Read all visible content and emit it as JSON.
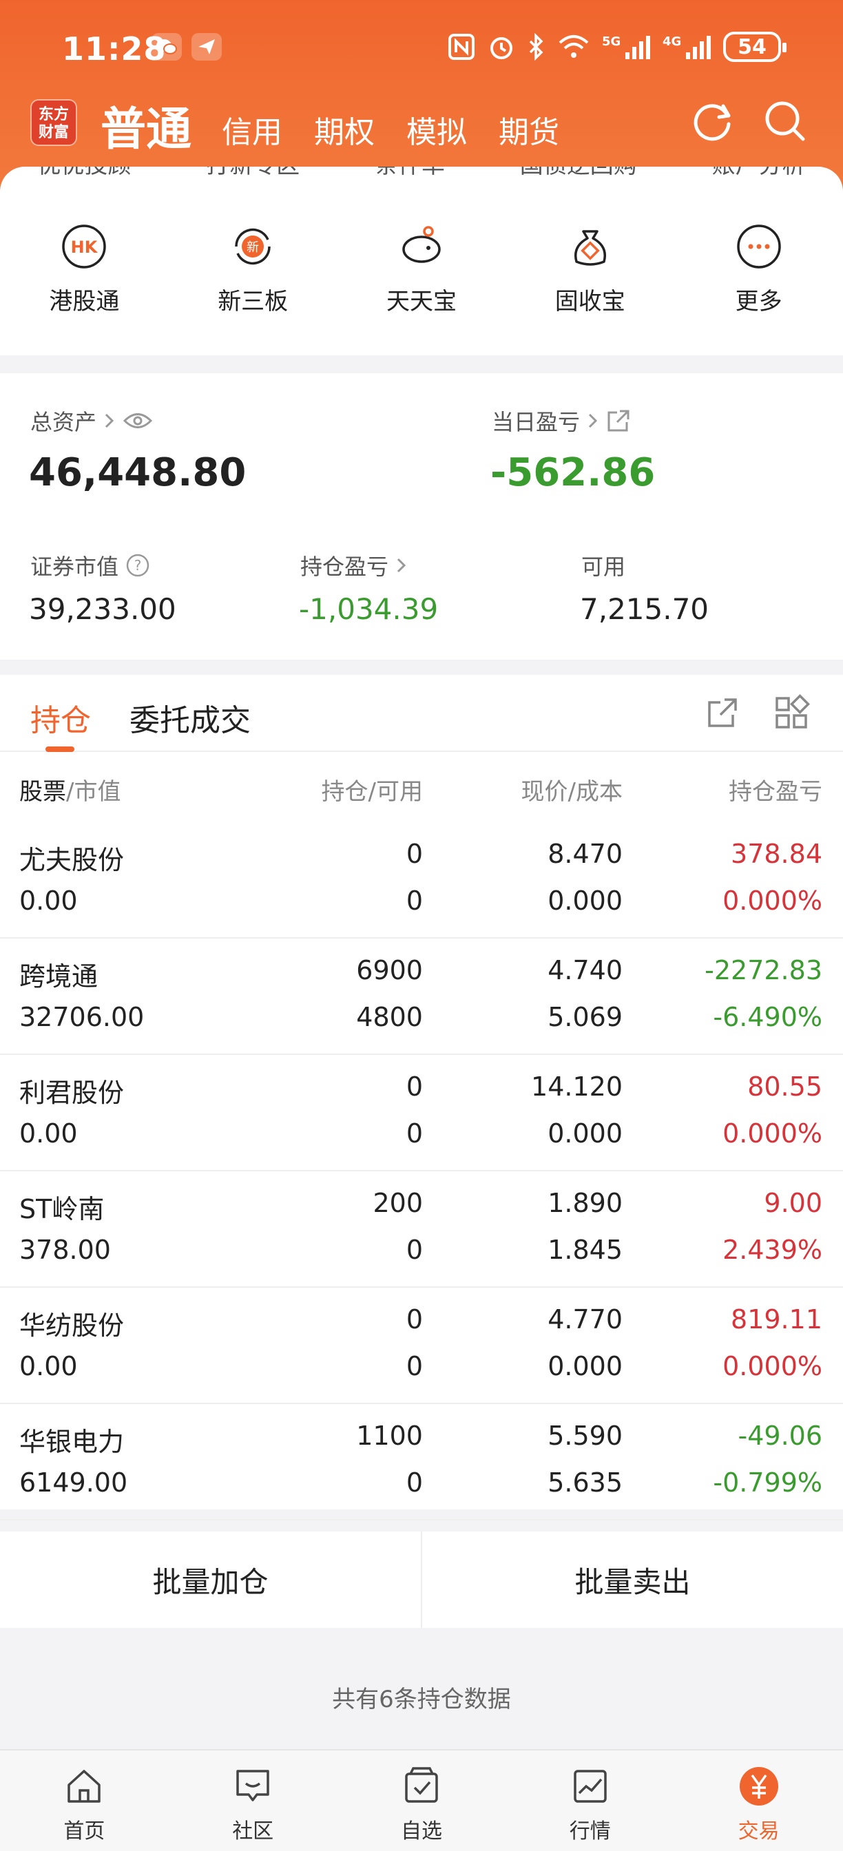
{
  "status": {
    "time": "11:28",
    "network": "5G 4G",
    "battery": "54"
  },
  "nav": {
    "logo": "东方财富",
    "main": "普通",
    "tabs": [
      "信用",
      "期权",
      "模拟",
      "期货"
    ]
  },
  "peek_row": [
    "优优投顾",
    "打新专区",
    "条件单",
    "国债逆回购",
    "账户分析"
  ],
  "quick": [
    {
      "label": "港股通",
      "icon": "hk-icon"
    },
    {
      "label": "新三板",
      "icon": "xin-icon"
    },
    {
      "label": "天天宝",
      "icon": "piggy-icon"
    },
    {
      "label": "固收宝",
      "icon": "bag-icon"
    },
    {
      "label": "更多",
      "icon": "more-icon"
    }
  ],
  "assets": {
    "total_label": "总资产",
    "total_value": "46,448.80",
    "daily_label": "当日盈亏",
    "daily_value": "-562.86",
    "market_label": "证券市值",
    "market_value": "39,233.00",
    "position_pl_label": "持仓盈亏",
    "position_pl_value": "-1,034.39",
    "available_label": "可用",
    "available_value": "7,215.70"
  },
  "tabs": {
    "holdings": "持仓",
    "orders": "委托成交"
  },
  "table": {
    "headers": {
      "stock": "股票",
      "market": "/市值",
      "qty": "持仓/可用",
      "price": "现价/成本",
      "pl": "持仓盈亏"
    },
    "rows": [
      {
        "name": "尤夫股份",
        "mv": "0.00",
        "qty": "0",
        "avail": "0",
        "price": "8.470",
        "cost": "0.000",
        "pl": "378.84",
        "plpct": "0.000%",
        "dir": "up"
      },
      {
        "name": "跨境通",
        "mv": "32706.00",
        "qty": "6900",
        "avail": "4800",
        "price": "4.740",
        "cost": "5.069",
        "pl": "-2272.83",
        "plpct": "-6.490%",
        "dir": "down"
      },
      {
        "name": "利君股份",
        "mv": "0.00",
        "qty": "0",
        "avail": "0",
        "price": "14.120",
        "cost": "0.000",
        "pl": "80.55",
        "plpct": "0.000%",
        "dir": "up"
      },
      {
        "name": "ST岭南",
        "mv": "378.00",
        "qty": "200",
        "avail": "0",
        "price": "1.890",
        "cost": "1.845",
        "pl": "9.00",
        "plpct": "2.439%",
        "dir": "up"
      },
      {
        "name": "华纺股份",
        "mv": "0.00",
        "qty": "0",
        "avail": "0",
        "price": "4.770",
        "cost": "0.000",
        "pl": "819.11",
        "plpct": "0.000%",
        "dir": "up"
      },
      {
        "name": "华银电力",
        "mv": "6149.00",
        "qty": "1100",
        "avail": "0",
        "price": "5.590",
        "cost": "5.635",
        "pl": "-49.06",
        "plpct": "-0.799%",
        "dir": "down"
      }
    ]
  },
  "actions": {
    "add": "批量加仓",
    "sell": "批量卖出"
  },
  "footer_note": "共有6条持仓数据",
  "bottom_nav": [
    "首页",
    "社区",
    "自选",
    "行情",
    "交易"
  ],
  "colors": {
    "accent": "#f0652d",
    "up": "#d6343a",
    "down": "#3a9b2e"
  }
}
